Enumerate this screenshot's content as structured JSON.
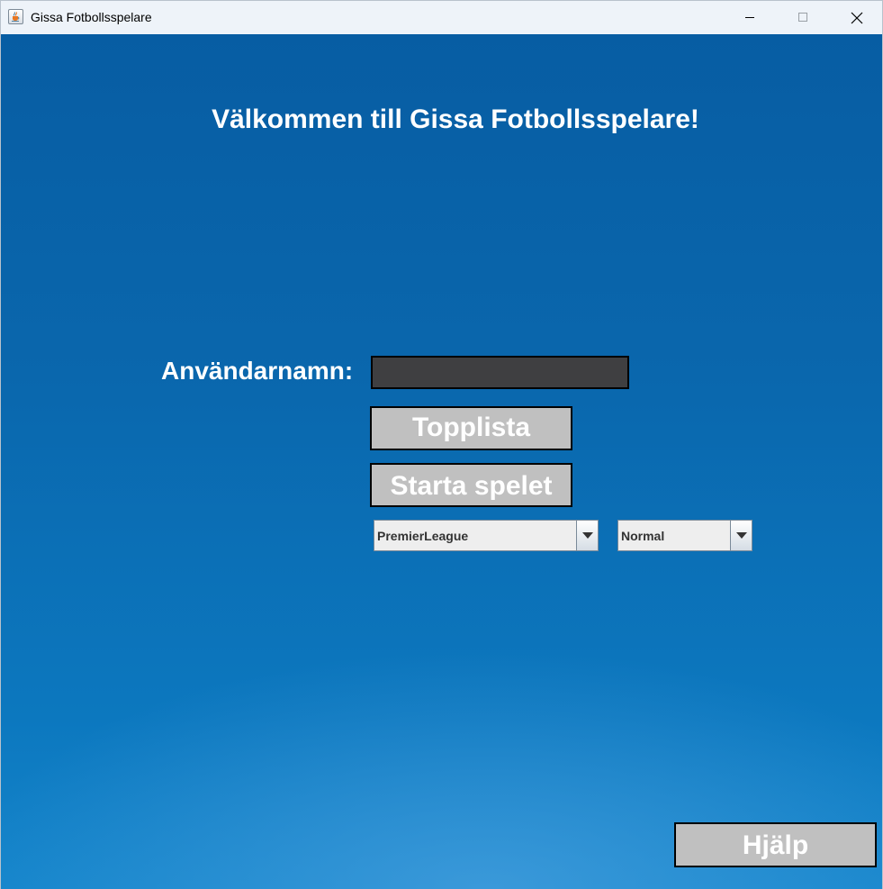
{
  "window": {
    "title": "Gissa Fotbollsspelare"
  },
  "main": {
    "heading": "Välkommen till Gissa Fotbollsspelare!",
    "username_label": "Användarnamn:",
    "username_value": "",
    "topplista_label": "Topplista",
    "start_label": "Starta spelet",
    "league_selected": "PremierLeague",
    "difficulty_selected": "Normal",
    "help_label": "Hjälp"
  },
  "icons": {
    "app": "java-cup-icon",
    "minimize": "minimize-icon",
    "maximize": "maximize-icon",
    "close": "close-icon",
    "dropdown": "triangle-down-icon"
  },
  "colors": {
    "background": "#0a67ad",
    "button_face": "#c0c0c0",
    "input_background": "#3f3f41",
    "text": "#ffffff"
  }
}
